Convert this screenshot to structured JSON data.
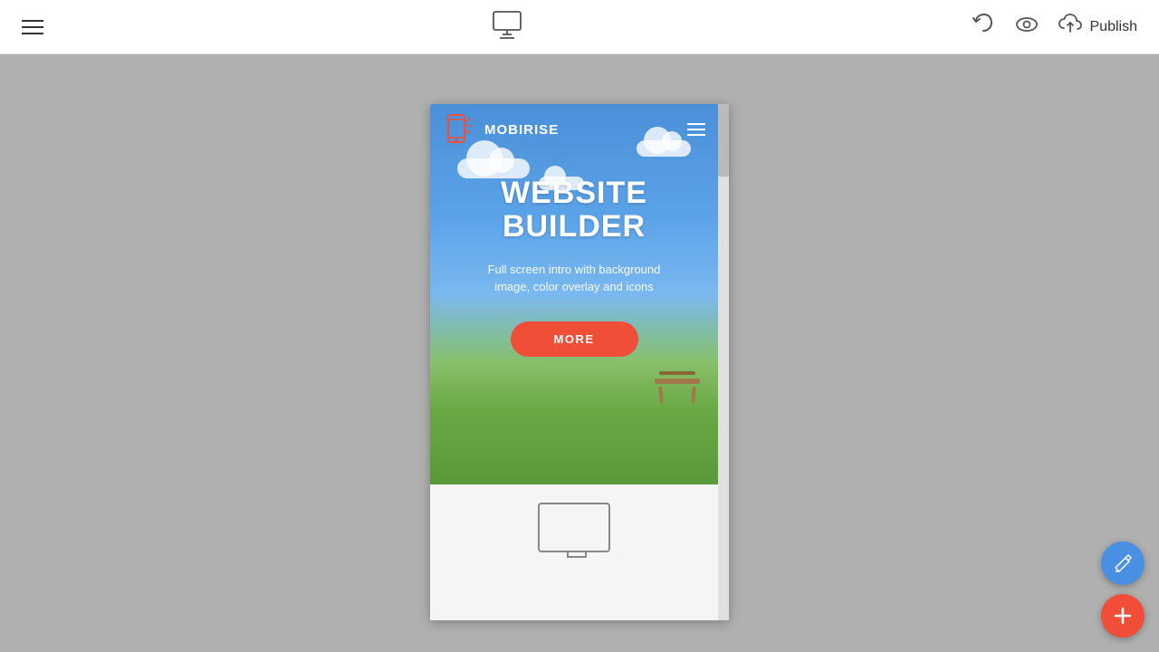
{
  "toolbar": {
    "menu_label": "Menu",
    "publish_label": "Publish"
  },
  "preview": {
    "brand_name": "MOBIRISE",
    "hero_title_line1": "WEBSITE",
    "hero_title_line2": "BUILDER",
    "hero_subtitle": "Full screen intro with background image, color overlay and icons",
    "hero_btn_label": "MORE"
  },
  "fabs": {
    "blue_label": "Edit",
    "red_label": "Add"
  }
}
